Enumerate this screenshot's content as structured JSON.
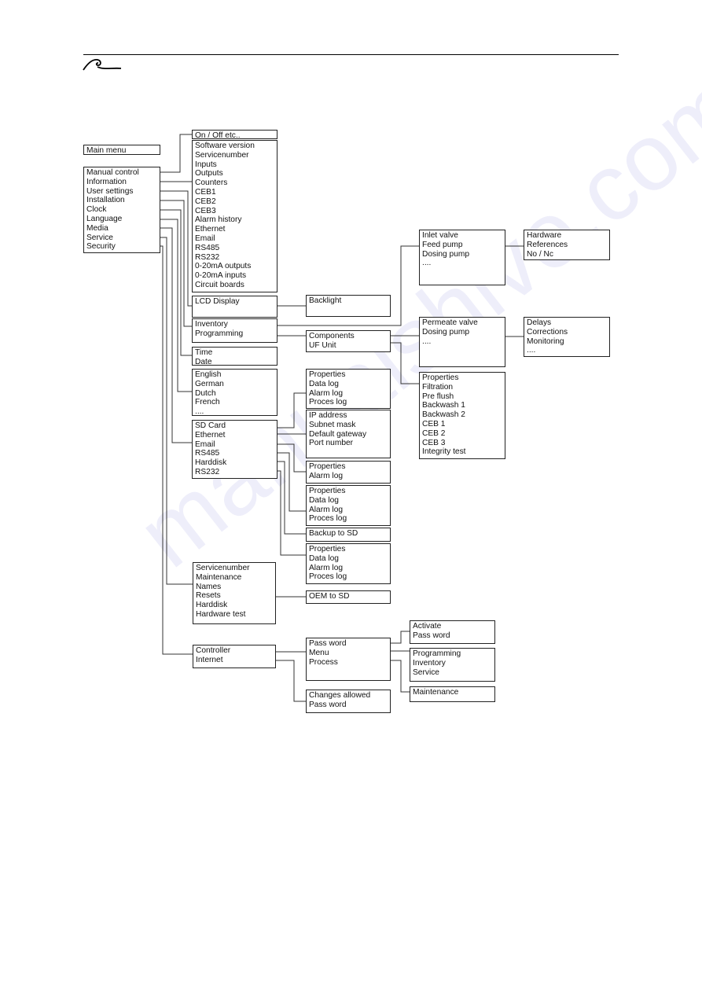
{
  "header": {
    "logo": "wave-logo"
  },
  "watermark": "manualshive.com",
  "boxes": {
    "main_title": [
      "Main menu"
    ],
    "main": [
      "Manual control",
      "Information",
      "User settings",
      "Installation",
      "Clock",
      "Language",
      "Media",
      "Service",
      "Security"
    ],
    "manual": [
      "On / Off etc.."
    ],
    "information": [
      "Software version",
      "Servicenumber",
      "Inputs",
      "Outputs",
      "Counters",
      "CEB1",
      "CEB2",
      "CEB3",
      "Alarm history",
      "Ethernet",
      "Email",
      "RS485",
      "RS232",
      "0-20mA outputs",
      "0-20mA inputs",
      "Circuit boards"
    ],
    "user_settings": [
      "LCD Display"
    ],
    "backlight": [
      "Backlight"
    ],
    "installation": [
      "Inventory",
      "Programming"
    ],
    "inventory_items": [
      "Inlet valve",
      "Feed pump",
      "Dosing pump",
      "...."
    ],
    "inventory_props": [
      "Hardware",
      "References",
      "No / Nc"
    ],
    "programming": [
      "Components",
      "UF Unit"
    ],
    "components": [
      "Permeate valve",
      "Dosing pump",
      "...."
    ],
    "component_props": [
      "Delays",
      "Corrections",
      "Monitoring",
      "...."
    ],
    "uf_unit": [
      "Properties",
      "Filtration",
      "Pre flush",
      "Backwash 1",
      "Backwash 2",
      "CEB 1",
      "CEB 2",
      "CEB 3",
      "Integrity test"
    ],
    "clock": [
      "Time",
      "Date"
    ],
    "language": [
      "English",
      "German",
      "Dutch",
      "French",
      "...."
    ],
    "media": [
      "SD Card",
      "Ethernet",
      "Email",
      "RS485",
      "Harddisk",
      "RS232"
    ],
    "sd_card": [
      "Properties",
      "Data log",
      "Alarm log",
      "Proces log"
    ],
    "ethernet": [
      "IP address",
      "Subnet mask",
      "Default gateway",
      "Port number"
    ],
    "email": [
      "Properties",
      "Alarm log"
    ],
    "rs485": [
      "Properties",
      "Data log",
      "Alarm log",
      "Proces log"
    ],
    "harddisk": [
      "Backup to SD"
    ],
    "rs232": [
      "Properties",
      "Data log",
      "Alarm log",
      "Proces log"
    ],
    "service": [
      "Servicenumber",
      "Maintenance",
      "Names",
      "Resets",
      "Harddisk",
      "Hardware test"
    ],
    "oem": [
      "OEM to SD"
    ],
    "security": [
      "Controller",
      "Internet"
    ],
    "controller": [
      "Pass word",
      "Menu",
      "Process"
    ],
    "internet": [
      "Changes allowed",
      "Pass word"
    ],
    "password": [
      "Activate",
      "Pass word"
    ],
    "menu": [
      "Programming",
      "Inventory",
      "Service"
    ],
    "process": [
      "Maintenance"
    ]
  }
}
